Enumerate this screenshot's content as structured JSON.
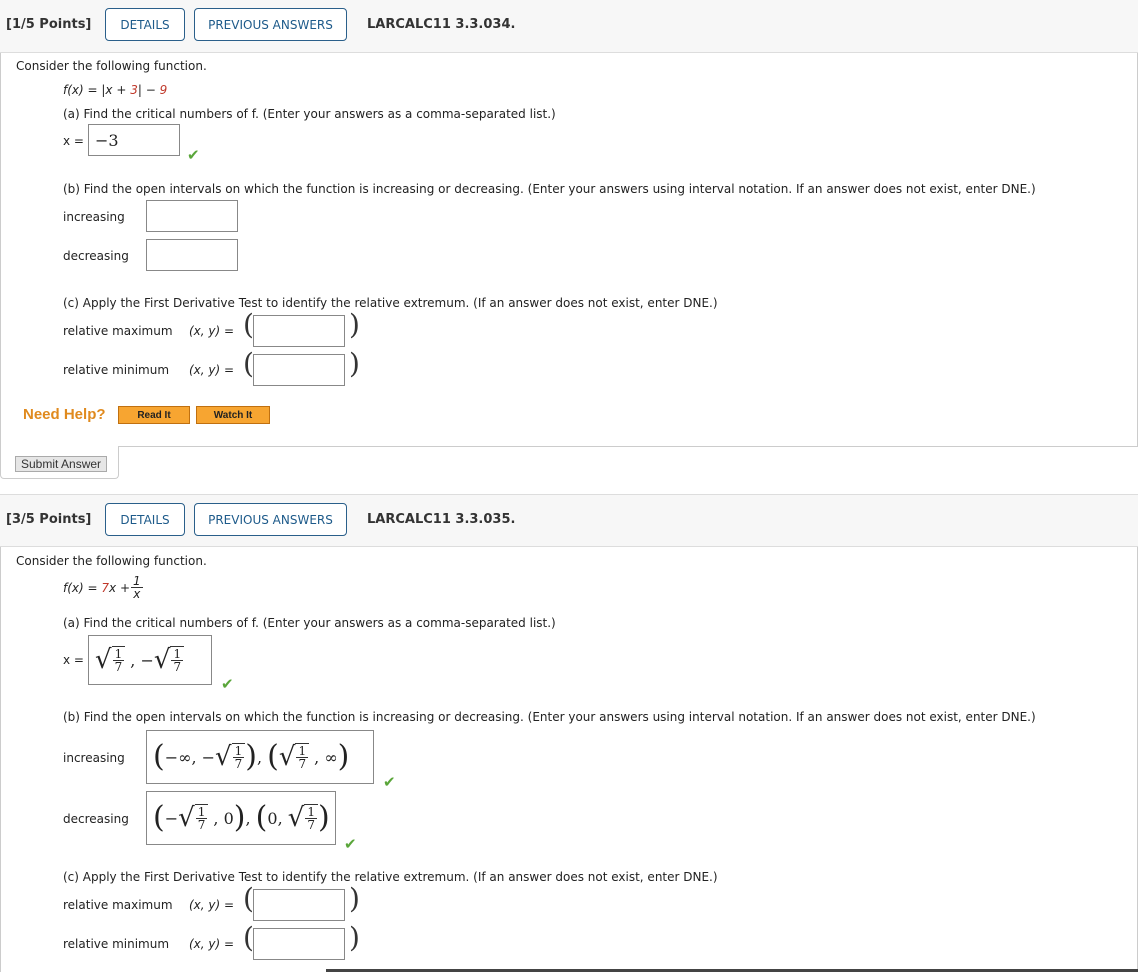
{
  "q1": {
    "points": "[1/5 Points]",
    "details": "DETAILS",
    "previous": "PREVIOUS ANSWERS",
    "code": "LARCALC11 3.3.034.",
    "intro": "Consider the following function.",
    "f_lhs": "f(x) = |x + ",
    "f_c1": "3",
    "f_mid": "| − ",
    "f_c2": "9",
    "a": "(a) Find the critical numbers of f. (Enter your answers as a comma-separated list.)",
    "x_label": "x =",
    "a_answer": "−3",
    "b": "(b) Find the open intervals on which the function is increasing or decreasing. (Enter your answers using interval notation. If an answer does not exist, enter DNE.)",
    "increasing": "increasing",
    "decreasing": "decreasing",
    "inc_answer": "",
    "dec_answer": "",
    "c": "(c) Apply the First Derivative Test to identify the relative extremum. (If an answer does not exist, enter DNE.)",
    "rel_max": "relative maximum",
    "rel_min": "relative minimum",
    "xy": "(x, y)  =",
    "max_answer": "",
    "min_answer": "",
    "need_help": "Need Help?",
    "read_it": "Read It",
    "watch_it": "Watch It",
    "submit": "Submit Answer"
  },
  "q2": {
    "points": "[3/5 Points]",
    "details": "DETAILS",
    "previous": "PREVIOUS ANSWERS",
    "code": "LARCALC11 3.3.035.",
    "intro": "Consider the following function.",
    "f_lhs": "f(x) = ",
    "f_c1": "7",
    "f_mid": "x + ",
    "f_num": "1",
    "f_den": "x",
    "a": "(a) Find the critical numbers of f. (Enter your answers as a comma-separated list.)",
    "x_label": "x =",
    "a_answer": [
      {
        "sqrt": [
          "1",
          "7"
        ]
      },
      {
        "text": " , −"
      },
      {
        "sqrt": [
          "1",
          "7"
        ]
      }
    ],
    "b": "(b) Find the open intervals on which the function is increasing or decreasing. (Enter your answers using interval notation. If an answer does not exist, enter DNE.)",
    "increasing": "increasing",
    "decreasing": "decreasing",
    "inc_answer": [
      {
        "paren": "("
      },
      {
        "text": "−∞, −"
      },
      {
        "sqrt": [
          "1",
          "7"
        ]
      },
      {
        "paren": ")"
      },
      {
        "text": ", "
      },
      {
        "paren": "("
      },
      {
        "sqrt": [
          "1",
          "7"
        ]
      },
      {
        "text": " , ∞"
      },
      {
        "paren": ")"
      }
    ],
    "dec_answer": [
      {
        "paren": "("
      },
      {
        "text": "−"
      },
      {
        "sqrt": [
          "1",
          "7"
        ]
      },
      {
        "text": " , 0"
      },
      {
        "paren": ")"
      },
      {
        "text": ", "
      },
      {
        "paren": "("
      },
      {
        "text": "0, "
      },
      {
        "sqrt": [
          "1",
          "7"
        ]
      },
      {
        "paren": ")"
      }
    ],
    "c": "(c) Apply the First Derivative Test to identify the relative extremum. (If an answer does not exist, enter DNE.)",
    "rel_max": "relative maximum",
    "rel_min": "relative minimum",
    "xy": "(x, y)  =",
    "max_answer": "",
    "min_answer": ""
  },
  "colors": {
    "accent": "#1d5a8a",
    "check": "#5aa63a",
    "help": "#e08a1e",
    "constant": "#c0392b"
  }
}
